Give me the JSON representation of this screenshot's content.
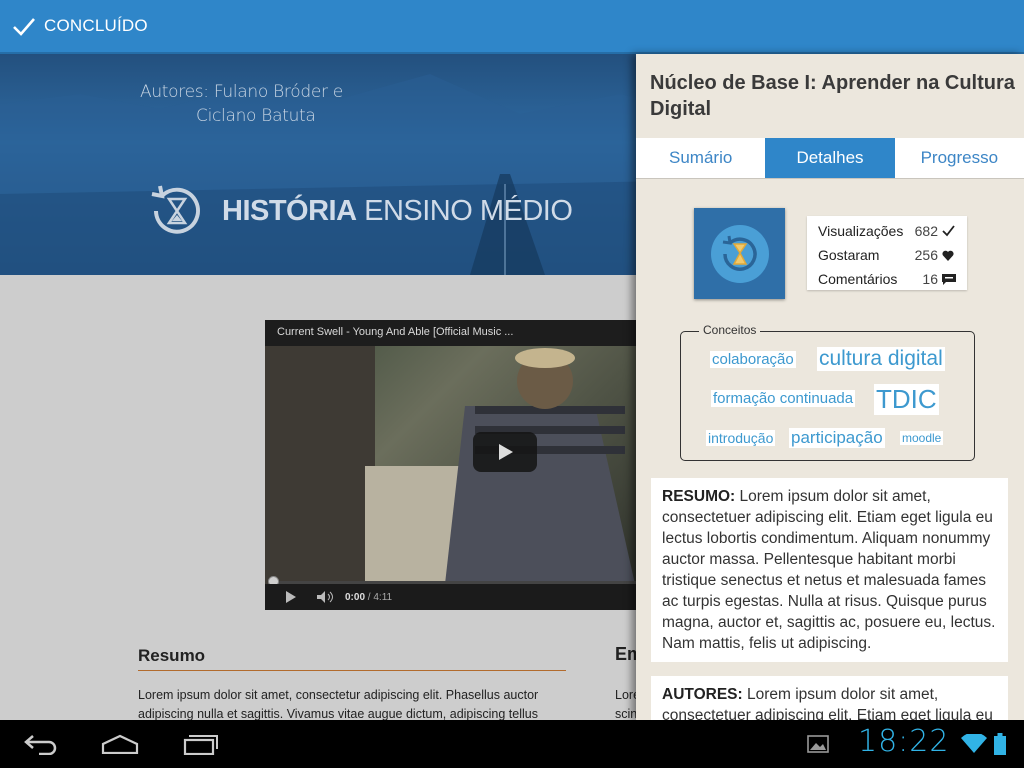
{
  "topbar": {
    "done_label": "CONCLUÍDO"
  },
  "hero": {
    "authors_line1": "Autores: Fulano Bróder e",
    "authors_line2": "Ciclano Batuta",
    "title_bold": "HISTÓRIA",
    "title_rest": " ENSINO MÉDIO"
  },
  "video": {
    "title": "Current Swell - Young And Able [Official Music ...",
    "time_current": "0:00",
    "time_total": "4:11"
  },
  "main": {
    "section_heading": "Resumo",
    "section_text": "Lorem ipsum dolor sit amet, consectetur adipiscing elit. Phasellus auctor adipiscing nulla et sagittis. Vivamus vitae augue dictum, adipiscing tellus",
    "right_heading": "Em",
    "right_text_1": "Lore",
    "right_text_2": "scin"
  },
  "panel": {
    "title": "Núcleo de Base I: Aprender na Cultura Digital",
    "tabs": [
      {
        "label": "Sumário"
      },
      {
        "label": "Detalhes"
      },
      {
        "label": "Progresso"
      }
    ],
    "active_tab": "Detalhes",
    "stats": [
      {
        "label": "Visualizações",
        "value": "682",
        "icon": "check-icon"
      },
      {
        "label": "Gostaram",
        "value": "256",
        "icon": "heart-icon"
      },
      {
        "label": "Comentários",
        "value": "16",
        "icon": "comment-icon"
      }
    ],
    "concepts_label": "Conceitos",
    "tags": [
      {
        "label": "colaboração"
      },
      {
        "label": "cultura digital"
      },
      {
        "label": "formação continuada"
      },
      {
        "label": "TDIC"
      },
      {
        "label": "introdução"
      },
      {
        "label": "participação"
      },
      {
        "label": "moodle"
      }
    ],
    "resumo_label": "RESUMO:",
    "resumo_text": " Lorem ipsum dolor sit amet, consectetuer adipiscing elit. Etiam eget ligula eu lectus lobortis condimentum. Aliquam nonummy auctor massa. Pellentesque habitant morbi tristique senectus et netus et malesuada fames ac turpis egestas. Nulla at risus. Quisque purus magna, auctor et, sagittis ac, posuere eu, lectus. Nam mattis, felis ut adipiscing.",
    "autores_label": "AUTORES:",
    "autores_text": " Lorem ipsum dolor sit amet, consectetuer adipiscing elit. Etiam eget ligula eu"
  },
  "statusbar": {
    "clock": "18:22"
  },
  "colors": {
    "accent": "#2f86c9",
    "tag": "#3d99cf",
    "clock": "#31b3e6"
  }
}
